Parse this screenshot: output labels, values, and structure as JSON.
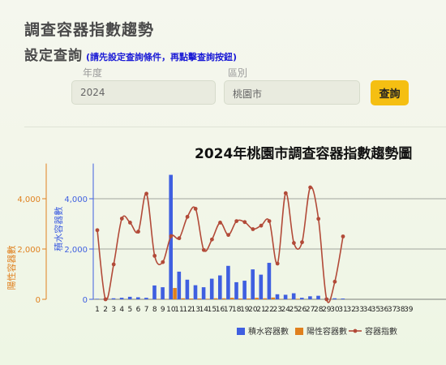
{
  "header": {
    "page_title": "調查容器指數趨勢",
    "section_title": "設定查詢",
    "section_hint": "(請先設定查詢條件，再點擊查詢按鈕)"
  },
  "form": {
    "year_label": "年度",
    "year_value": "2024",
    "district_label": "區別",
    "district_value": "桃園市",
    "query_label": "查詢"
  },
  "colors": {
    "blue": "#3f5fe0",
    "orange": "#e0801e",
    "line": "#b24a38",
    "query": "#f5bf12"
  },
  "chart_data": {
    "type": "bar",
    "title": "2024年桃園市調查容器指數趨勢圖",
    "x": [
      1,
      2,
      3,
      4,
      5,
      6,
      7,
      8,
      9,
      10,
      11,
      12,
      13,
      14,
      15,
      16,
      17,
      18,
      19,
      20,
      21,
      22,
      23,
      24,
      25,
      26,
      27,
      28,
      29,
      30,
      31,
      32,
      33,
      34,
      35,
      36,
      37,
      38,
      39
    ],
    "left_axis": {
      "label": "陽性容器數",
      "ticks": [
        0,
        2000,
        4000
      ],
      "ylim": [
        0,
        5400
      ]
    },
    "inner_axis": {
      "label": "積水容器數",
      "ticks": [
        0,
        2000,
        4000
      ],
      "ylim": [
        0,
        5400
      ]
    },
    "legend": [
      "積水容器數",
      "陽性容器數",
      "容器指數"
    ],
    "grid": true,
    "series": [
      {
        "name": "積水容器數",
        "type": "bar",
        "values": [
          20,
          30,
          40,
          60,
          100,
          80,
          60,
          550,
          480,
          4950,
          1100,
          780,
          560,
          480,
          820,
          950,
          1330,
          680,
          740,
          1190,
          980,
          1450,
          200,
          180,
          240,
          60,
          120,
          140,
          50,
          40,
          30,
          0,
          0,
          0,
          0,
          0,
          0,
          0,
          0
        ]
      },
      {
        "name": "陽性容器數",
        "type": "bar",
        "values": [
          0,
          0,
          0,
          0,
          0,
          0,
          0,
          10,
          10,
          450,
          40,
          30,
          30,
          20,
          40,
          40,
          60,
          30,
          30,
          60,
          40,
          70,
          10,
          10,
          20,
          0,
          0,
          0,
          0,
          0,
          0,
          0,
          0,
          0,
          0,
          0,
          0,
          0,
          0
        ]
      },
      {
        "name": "容器指數",
        "type": "line",
        "values": [
          2750,
          0,
          1390,
          3210,
          3050,
          2690,
          4200,
          1730,
          1480,
          2510,
          2430,
          3280,
          3600,
          1960,
          2380,
          3050,
          2560,
          3110,
          3070,
          2790,
          2930,
          3110,
          1420,
          4220,
          2240,
          2270,
          4450,
          3200,
          0,
          700,
          2500
        ]
      }
    ]
  }
}
